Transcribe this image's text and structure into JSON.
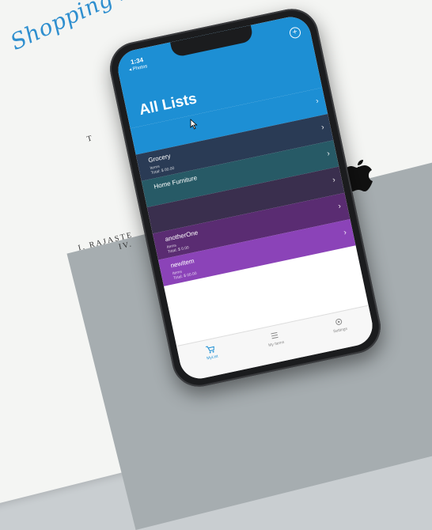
{
  "backdrop": {
    "app_title": "Shopping List App",
    "book_line_1": "T",
    "book_line_2": "I. RAJASTE",
    "book_line_3": "IV."
  },
  "status_bar": {
    "time": "1:34",
    "back_label": "◂ Photos"
  },
  "nav": {
    "title": "All Lists",
    "add_icon": "plus-circle-icon"
  },
  "lists": [
    {
      "name": "",
      "sub": "",
      "date": "",
      "color": "#1d8fd4"
    },
    {
      "name": "Grocery",
      "sub": "Items\nTotal: $ 00.00",
      "date": "",
      "color": "#2a3b55"
    },
    {
      "name": "Home Furniture",
      "sub": "",
      "date": "",
      "color": "#275a66"
    },
    {
      "name": "",
      "sub": "",
      "date": "",
      "color": "#3a2f4e"
    },
    {
      "name": "anotherOne",
      "sub": "Items\nTotal: $ 0.00",
      "date": "",
      "color": "#5a2c72"
    },
    {
      "name": "newItem",
      "sub": "Items\nTotal: $ 00.00",
      "date": "",
      "color": "#8b43b8"
    }
  ],
  "tabs": [
    {
      "label": "MyList",
      "icon": "cart-icon",
      "active": true
    },
    {
      "label": "My Items",
      "icon": "list-icon",
      "active": false
    },
    {
      "label": "Settings",
      "icon": "gear-icon",
      "active": false
    }
  ],
  "colors": {
    "accent": "#1d8fd4",
    "tab_inactive": "#888888"
  }
}
